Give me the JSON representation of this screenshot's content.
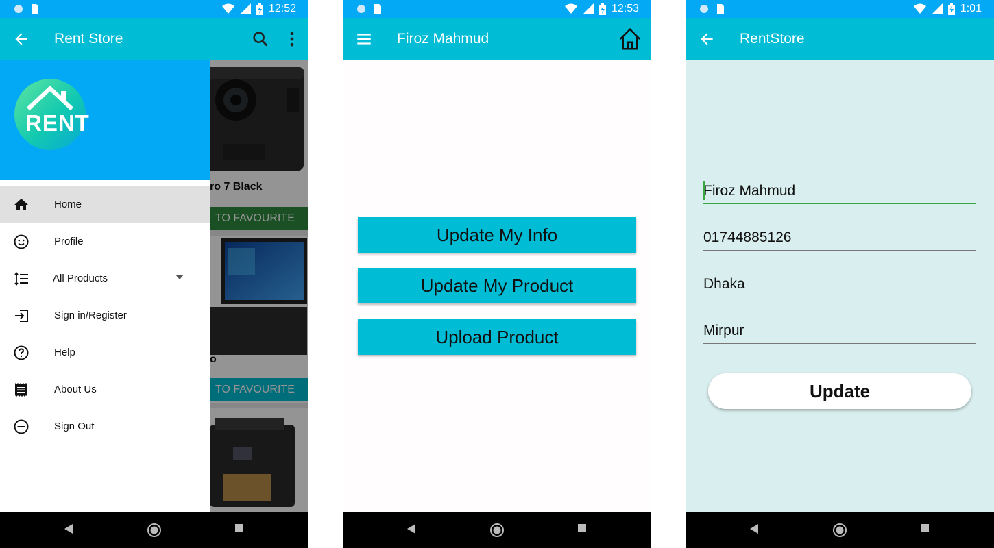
{
  "system": {
    "phone1_time": "12:52",
    "phone2_time": "12:53",
    "phone3_time": "1:01"
  },
  "phone1": {
    "title": "Rent Store",
    "logo_text": "RENT",
    "menu": [
      {
        "label": "Home",
        "icon": "home-icon"
      },
      {
        "label": "Profile",
        "icon": "smiley-icon"
      },
      {
        "label": "All Products",
        "icon": "list-icon"
      },
      {
        "label": "Sign in/Register",
        "icon": "sign-in-icon"
      },
      {
        "label": "Help",
        "icon": "help-icon"
      },
      {
        "label": "About Us",
        "icon": "receipt-icon"
      },
      {
        "label": "Sign Out",
        "icon": "minus-circle-icon"
      }
    ],
    "background_products": {
      "item1_name": "ro 7 Black",
      "fav1": "TO FAVOURITE",
      "item2_name": "o",
      "fav2": "TO FAVOURITE"
    }
  },
  "phone2": {
    "title": "Firoz Mahmud",
    "buttons": [
      "Update My Info",
      "Update My Product",
      "Upload Product"
    ]
  },
  "phone3": {
    "title": "RentStore",
    "fields": [
      "Firoz Mahmud",
      "01744885126",
      "Dhaka",
      "Mirpur"
    ],
    "update_label": "Update"
  },
  "colors": {
    "statusbar": "#03a9f4",
    "appbar": "#00bcd4",
    "fav_green": "#2e8b3e",
    "fav_cyan": "#00bcd4"
  }
}
